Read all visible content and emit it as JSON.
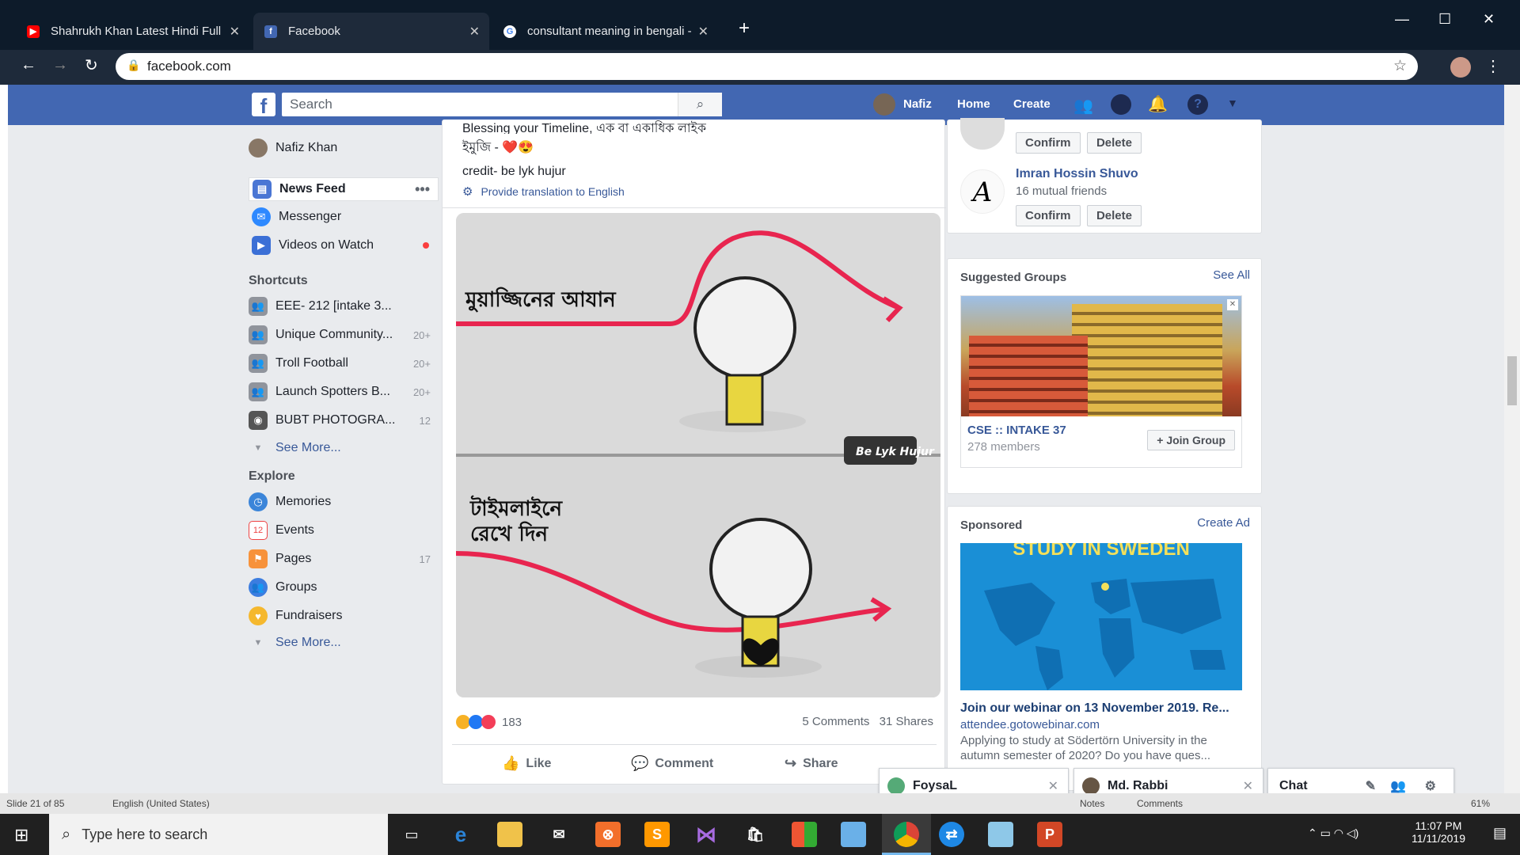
{
  "browser": {
    "tabs": [
      {
        "title": "Shahrukh Khan Latest Hindi Full"
      },
      {
        "title": "Facebook"
      },
      {
        "title": "consultant meaning in bengali -"
      }
    ],
    "url": "facebook.com"
  },
  "fb_header": {
    "search_placeholder": "Search",
    "profile_name": "Nafiz",
    "home": "Home",
    "create": "Create"
  },
  "left_nav": {
    "user": "Nafiz Khan",
    "main": [
      {
        "label": "News Feed"
      },
      {
        "label": "Messenger"
      },
      {
        "label": "Videos on Watch"
      }
    ],
    "shortcuts_title": "Shortcuts",
    "shortcuts": [
      {
        "label": "EEE- 212 [intake 3...",
        "count": ""
      },
      {
        "label": "Unique Community...",
        "count": "20+"
      },
      {
        "label": "Troll Football",
        "count": "20+"
      },
      {
        "label": "Launch Spotters B...",
        "count": "20+"
      },
      {
        "label": "BUBT PHOTOGRA...",
        "count": "12"
      }
    ],
    "see_more": "See More...",
    "explore_title": "Explore",
    "explore": [
      {
        "label": "Memories",
        "count": ""
      },
      {
        "label": "Events",
        "count": ""
      },
      {
        "label": "Pages",
        "count": "17"
      },
      {
        "label": "Groups",
        "count": ""
      },
      {
        "label": "Fundraisers",
        "count": ""
      }
    ],
    "see_more2": "See More..."
  },
  "post": {
    "text_top": "Blessing your Timeline, এক বা একাধিক লাইক",
    "text_line2": "ইমুজি - ❤️😍",
    "credit": "credit- be lyk hujur",
    "translate": "Provide translation to English",
    "image_text1": "মুয়াজ্জিনের আযান",
    "image_text2": "টাইমলাইনে",
    "image_text3": "রেখে দিন",
    "watermark": "Be Lyk Hujur",
    "reactions": "183",
    "comments": "5 Comments",
    "shares": "31 Shares",
    "like": "Like",
    "comment": "Comment",
    "share": "Share"
  },
  "right": {
    "confirm": "Confirm",
    "delete": "Delete",
    "friend_name": "Imran Hossin Shuvo",
    "mutual": "16 mutual friends",
    "suggested_title": "Suggested Groups",
    "see_all": "See All",
    "group_name": "CSE :: INTAKE 37",
    "group_members": "278 members",
    "join": "Join Group",
    "sponsored": "Sponsored",
    "create_ad": "Create Ad",
    "ad_banner": "STUDY IN SWEDEN",
    "ad_title": "Join our webinar on 13 November 2019. Re...",
    "ad_domain": "attendee.gotowebinar.com",
    "ad_desc1": "Applying to study at Södertörn University in the",
    "ad_desc2": "autumn semester of 2020? Do you have ques..."
  },
  "chats": {
    "c1": "FoysaL",
    "c2": "Md. Rabbi",
    "chat": "Chat"
  },
  "status": {
    "slide": "Slide 21 of 85",
    "lang": "English (United States)",
    "notes": "Notes",
    "comments": "Comments",
    "zoom": "61%"
  },
  "taskbar": {
    "search": "Type here to search",
    "time": "11:07 PM",
    "date": "11/11/2019"
  }
}
